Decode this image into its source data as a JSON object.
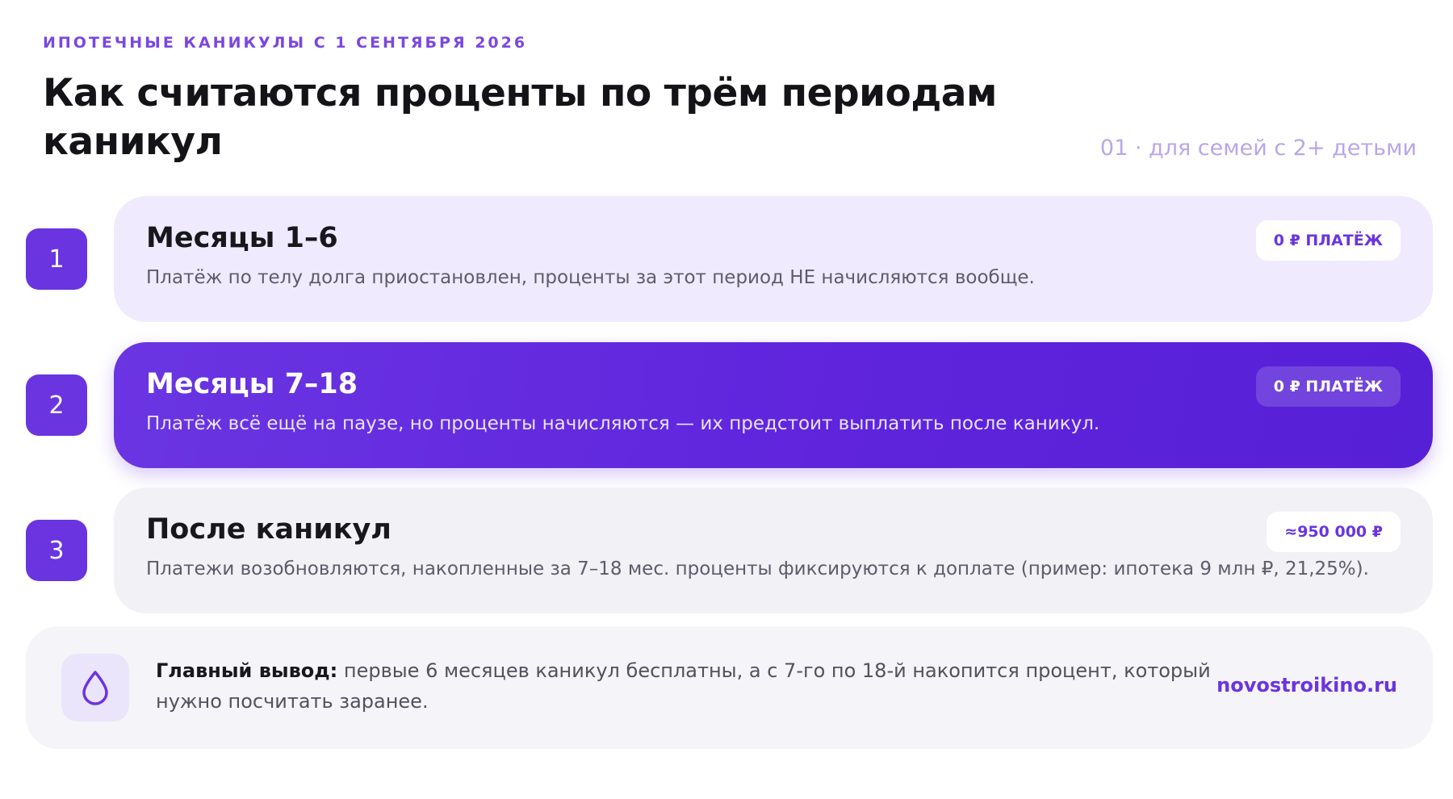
{
  "header": {
    "eyebrow": "ИПОТЕЧНЫЕ КАНИКУЛЫ С 1 СЕНТЯБРЯ 2026",
    "title": "Как считаются проценты по трём периодам каникул",
    "subtitle": "01 · для семей с 2+ детьми"
  },
  "steps": [
    {
      "number": "1",
      "title": "Месяцы 1–6",
      "description": "Платёж по телу долга приостановлен, проценты за этот период НЕ начисляются вообще.",
      "badge": "0 ₽ ПЛАТЁЖ",
      "style": "light"
    },
    {
      "number": "2",
      "title": "Месяцы 7–18",
      "description": "Платёж всё ещё на паузе, но проценты начисляются — их предстоит выплатить после каникул.",
      "badge": "0 ₽ ПЛАТЁЖ",
      "style": "active"
    },
    {
      "number": "3",
      "title": "После каникул",
      "description": "Платежи возобновляются, накопленные за 7–18 мес. проценты фиксируются к доплате (пример: ипотека 9 млн ₽, 21,25%).",
      "badge": "≈950 000 ₽",
      "style": "gray"
    }
  ],
  "conclusion": {
    "icon": "drop-icon",
    "label": "Главный вывод:",
    "text": " первые 6 месяцев каникул бесплатны, а с 7-го по 18-й накопится процент, который нужно посчитать заранее.",
    "link": "novostroikino.ru"
  },
  "colors": {
    "accent": "#6a34e0",
    "eyebrow": "#7a47e0",
    "subtitle": "#b9a6ea",
    "card_light": "#efeafd",
    "card_gray": "#f2f1f6"
  }
}
